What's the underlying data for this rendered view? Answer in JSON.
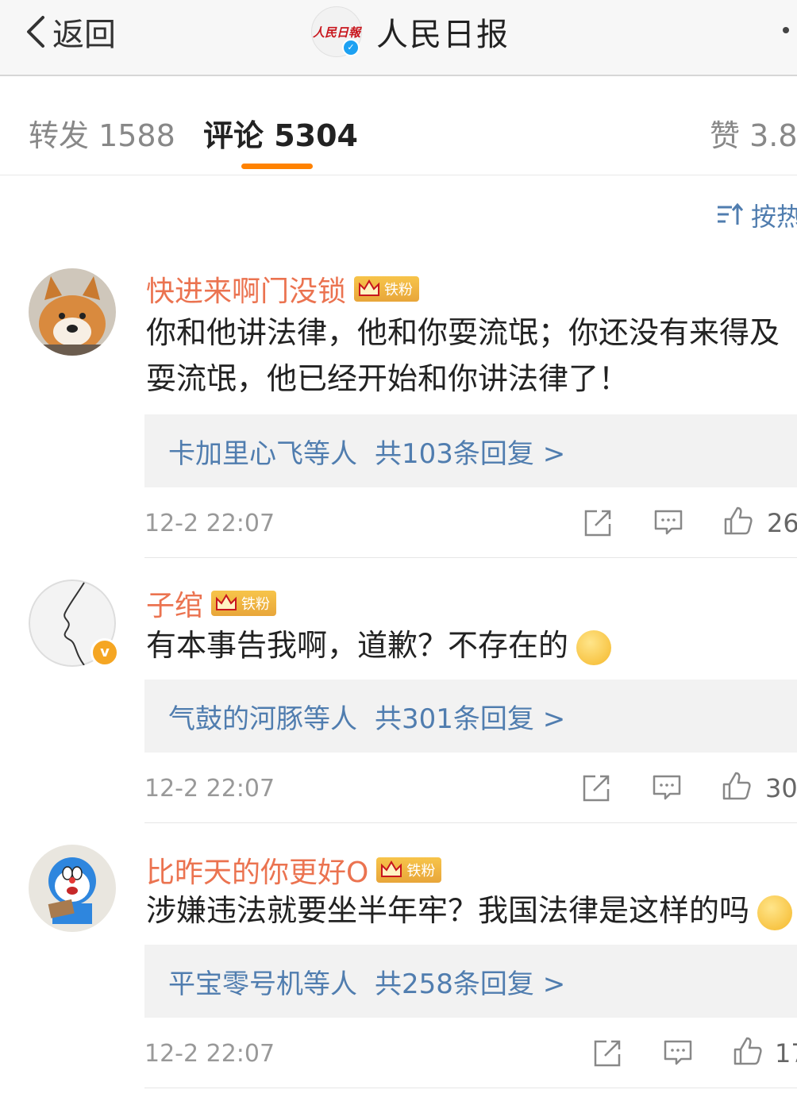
{
  "header": {
    "back_label": "返回",
    "account_name": "人民日报",
    "logo_text": "人民日報"
  },
  "tabs": {
    "repost": "转发 1588",
    "comment": "评论 5304",
    "like": "赞 3.8"
  },
  "sort_label": "按热",
  "colors": {
    "accent": "#ff8200",
    "username": "#eb7350",
    "link": "#507daf"
  },
  "comments": [
    {
      "username": "快进来啊门没锁",
      "badge": "铁粉",
      "text_line1": "你和他讲法律，他和你耍流氓；你还没有来得及",
      "text_line2": "耍流氓，他已经开始和你讲法律了！",
      "reply_users": "卡加里心飞等人",
      "reply_count": "共103条回复 >",
      "time": "12-2 22:07",
      "likes": "26"
    },
    {
      "username": "子绾",
      "badge": "铁粉",
      "text_line1": "有本事告我啊，道歉？不存在的",
      "reply_users": "气鼓的河豚等人",
      "reply_count": "共301条回复 >",
      "time": "12-2 22:07",
      "likes": "30"
    },
    {
      "username": "比昨天的你更好O",
      "badge": "铁粉",
      "text_line1": "涉嫌违法就要坐半年牢？我国法律是这样的吗",
      "reply_users": "平宝零号机等人",
      "reply_count": "共258条回复 >",
      "time": "12-2 22:07",
      "likes": "17"
    }
  ]
}
